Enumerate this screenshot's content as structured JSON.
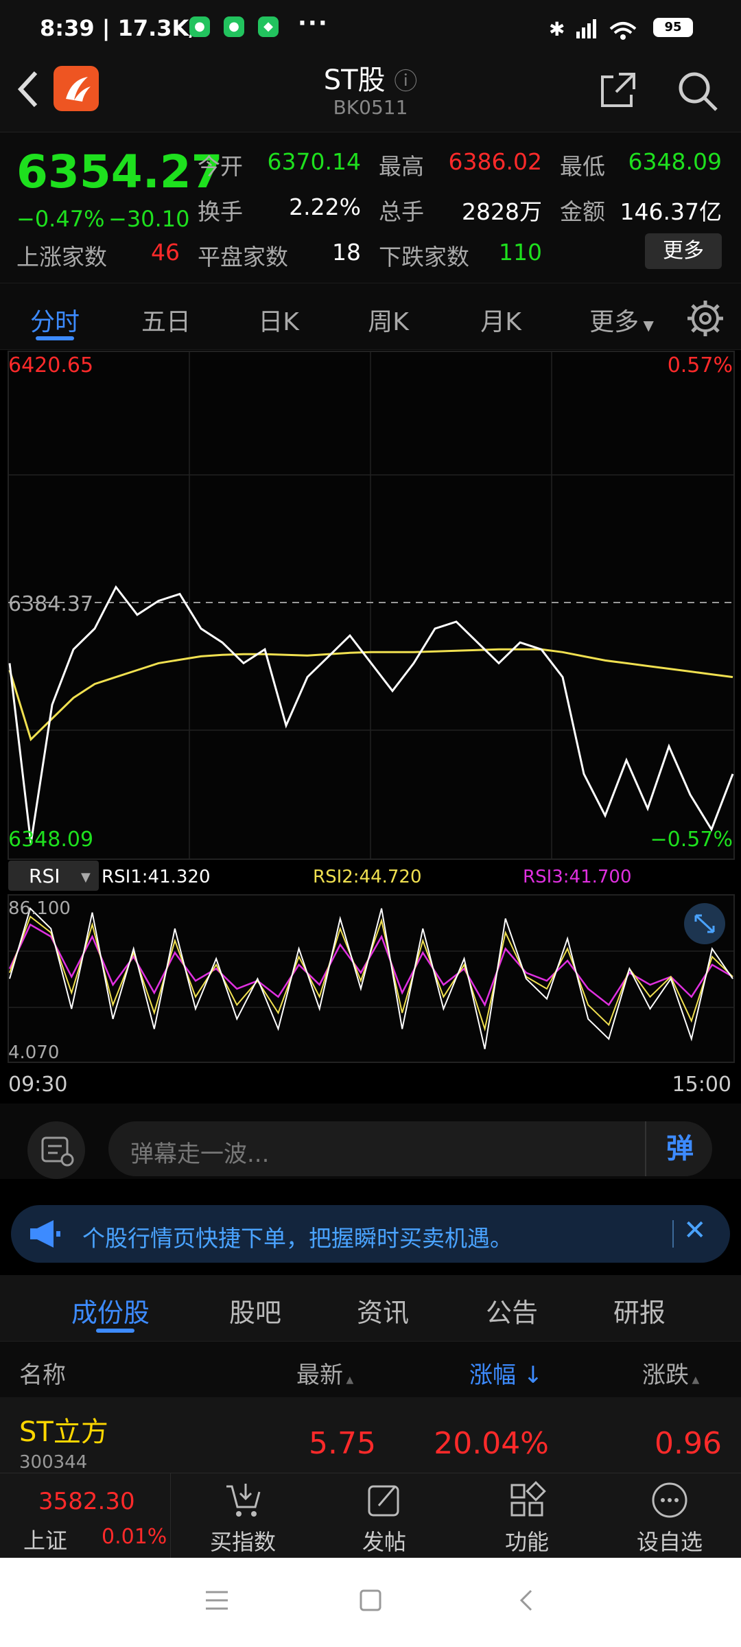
{
  "status_bar": {
    "time_speed": "8:39 | 17.3K/s",
    "more_dots": "···",
    "battery": "95"
  },
  "header": {
    "title": "ST股",
    "code": "BK0511"
  },
  "quote": {
    "price": "6354.27",
    "change_pct": "−0.47%",
    "change_abs": "−30.10",
    "open_label": "今开",
    "open": "6370.14",
    "high_label": "最高",
    "high": "6386.02",
    "low_label": "最低",
    "low": "6348.09",
    "turnover_label": "换手",
    "turnover": "2.22%",
    "volume_label": "总手",
    "volume": "2828万",
    "amount_label": "金额",
    "amount": "146.37亿",
    "up_label": "上涨家数",
    "up": "46",
    "flat_label": "平盘家数",
    "flat": "18",
    "down_label": "下跌家数",
    "down": "110",
    "more_button": "更多"
  },
  "period_tabs": [
    "分时",
    "五日",
    "日K",
    "周K",
    "月K",
    "更多"
  ],
  "chart_data": [
    {
      "type": "line",
      "title": "",
      "ylim": [
        6348.09,
        6420.65
      ],
      "y_labels": {
        "top_left": "6420.65",
        "mid_left": "6384.37",
        "bottom_left": "6348.09",
        "top_right": "0.57%",
        "bottom_right": "−0.57%"
      },
      "x_labels": [
        "09:30",
        "15:00"
      ],
      "series": [
        {
          "color": "#ffffff",
          "values": [
            6376,
            6350,
            6370,
            6378,
            6381,
            6387,
            6383,
            6385,
            6386,
            6381,
            6379,
            6376,
            6378,
            6367,
            6374,
            6377,
            6380,
            6376,
            6372,
            6376,
            6381,
            6382,
            6379,
            6376,
            6379,
            6378,
            6374,
            6360,
            6354,
            6362,
            6355,
            6364,
            6357,
            6352,
            6360
          ]
        },
        {
          "color": "#f0e050",
          "values": [
            6375,
            6365,
            6368,
            6371,
            6373,
            6374,
            6375,
            6376,
            6376.5,
            6377,
            6377.2,
            6377.3,
            6377.3,
            6377.2,
            6377.1,
            6377.3,
            6377.5,
            6377.6,
            6377.6,
            6377.6,
            6377.7,
            6377.8,
            6377.9,
            6378,
            6378,
            6378,
            6377.6,
            6377,
            6376.4,
            6376,
            6375.6,
            6375.2,
            6374.8,
            6374.4,
            6374
          ]
        }
      ]
    },
    {
      "type": "line",
      "indicator": "RSI",
      "ylim": [
        4.07,
        86.1
      ],
      "y_labels": {
        "top": "86.100",
        "bottom": "4.070"
      },
      "legend": [
        {
          "name": "RSI1:41.320",
          "color": "#ffffff"
        },
        {
          "name": "RSI2:44.720",
          "color": "#f0e050"
        },
        {
          "name": "RSI3:41.700",
          "color": "#e030e0"
        }
      ],
      "series": [
        {
          "name": "RSI1",
          "color": "#ffffff",
          "values": [
            45,
            80,
            70,
            30,
            78,
            25,
            60,
            20,
            70,
            30,
            55,
            25,
            45,
            20,
            60,
            30,
            75,
            40,
            80,
            20,
            70,
            30,
            55,
            10,
            75,
            45,
            35,
            65,
            25,
            15,
            50,
            30,
            45,
            15,
            60,
            45
          ]
        },
        {
          "name": "RSI2",
          "color": "#f0e050",
          "values": [
            48,
            76,
            68,
            38,
            72,
            32,
            58,
            28,
            64,
            36,
            52,
            32,
            44,
            28,
            56,
            36,
            70,
            44,
            74,
            28,
            64,
            36,
            52,
            20,
            68,
            46,
            40,
            60,
            32,
            22,
            50,
            36,
            46,
            24,
            56,
            46
          ]
        },
        {
          "name": "RSI3",
          "color": "#e030e0",
          "values": [
            50,
            72,
            66,
            46,
            66,
            42,
            56,
            38,
            58,
            44,
            50,
            40,
            44,
            36,
            52,
            42,
            62,
            48,
            66,
            38,
            58,
            42,
            50,
            32,
            60,
            48,
            44,
            54,
            40,
            32,
            48,
            42,
            46,
            36,
            52,
            46
          ]
        }
      ]
    }
  ],
  "rsi_selector": "RSI",
  "danmu": {
    "placeholder": "弹幕走一波...",
    "send_label": "弹"
  },
  "banner": {
    "text": "个股行情页快捷下单，把握瞬时买卖机遇。"
  },
  "sub_tabs": [
    "成份股",
    "股吧",
    "资讯",
    "公告",
    "研报"
  ],
  "list_header": {
    "name": "名称",
    "latest": "最新",
    "change_pct": "涨幅 ↓",
    "change": "涨跌"
  },
  "rows": [
    {
      "name": "ST立方",
      "code": "300344",
      "latest": "5.75",
      "change_pct": "20.04%",
      "change": "0.96"
    }
  ],
  "bottom_nav": {
    "index_value": "3582.30",
    "index_name": "上证",
    "index_change": "0.01%",
    "items": [
      "买指数",
      "发帖",
      "功能",
      "设自选"
    ]
  }
}
